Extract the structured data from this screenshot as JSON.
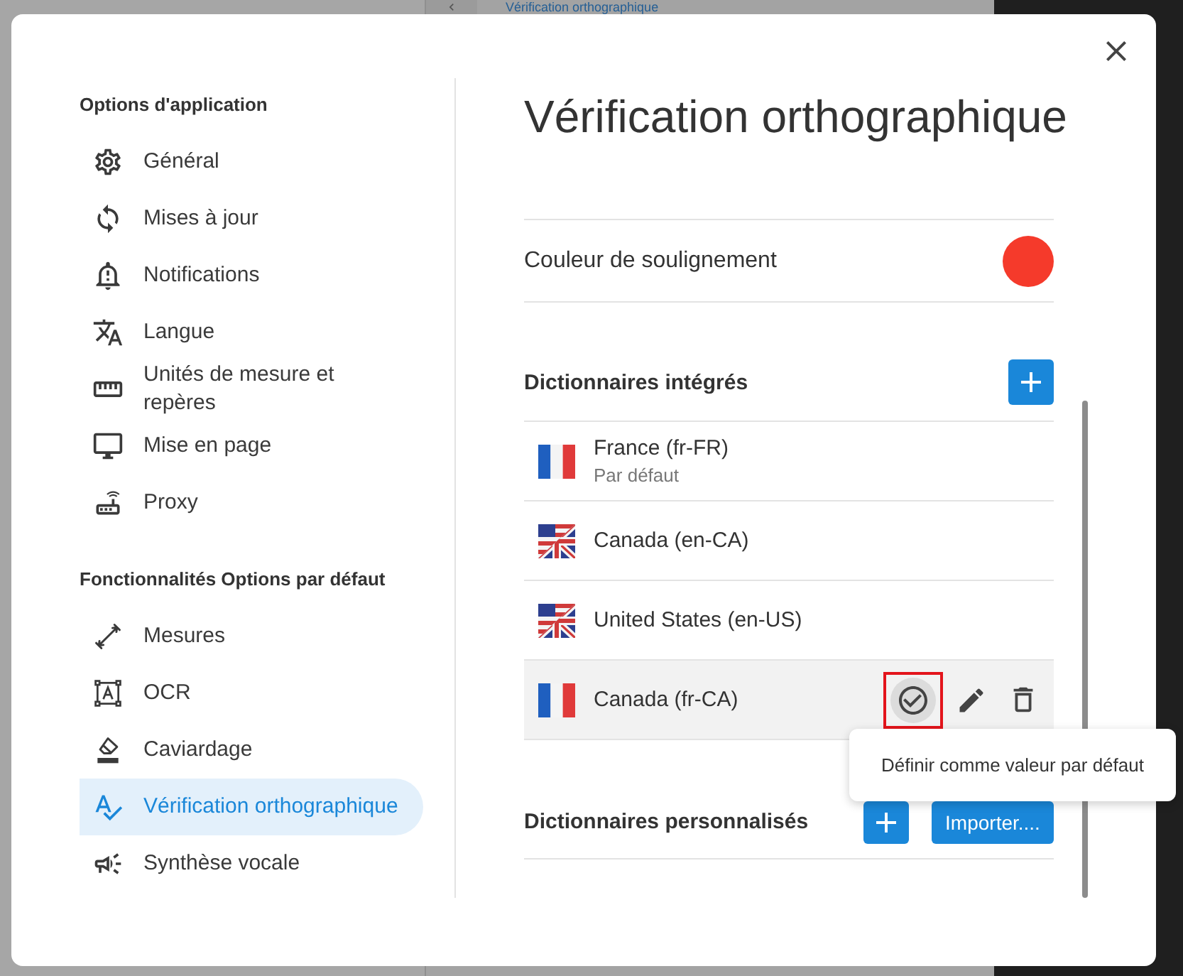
{
  "backdrop": {
    "heading": "Vérification orthographique"
  },
  "sidebar": {
    "sections": [
      {
        "title": "Options d'application",
        "items": [
          {
            "label": "Général",
            "selected": false
          },
          {
            "label": "Mises à jour",
            "selected": false
          },
          {
            "label": "Notifications",
            "selected": false
          },
          {
            "label": "Langue",
            "selected": false
          },
          {
            "label": "Unités de mesure et repères",
            "selected": false
          },
          {
            "label": "Mise en page",
            "selected": false
          },
          {
            "label": "Proxy",
            "selected": false
          }
        ]
      },
      {
        "title": "Fonctionnalités Options par défaut",
        "items": [
          {
            "label": "Mesures",
            "selected": false
          },
          {
            "label": "OCR",
            "selected": false
          },
          {
            "label": "Caviardage",
            "selected": false
          },
          {
            "label": "Vérification orthographique",
            "selected": true
          },
          {
            "label": "Synthèse vocale",
            "selected": false
          }
        ]
      }
    ]
  },
  "page": {
    "title": "Vérification orthographique",
    "underline_color": {
      "label": "Couleur de soulignement",
      "color": "#f53a2b"
    },
    "builtin_dictionaries": {
      "title": "Dictionnaires intégrés",
      "items": [
        {
          "name": "France (fr-FR)",
          "subtitle": "Par défaut",
          "kind": "french",
          "hovered": false
        },
        {
          "name": "Canada (en-CA)",
          "kind": "english",
          "hovered": false
        },
        {
          "name": "United States (en-US)",
          "kind": "english",
          "hovered": false
        },
        {
          "name": "Canada (fr-CA)",
          "kind": "french",
          "hovered": true
        }
      ]
    },
    "tooltip": {
      "text": "Définir comme valeur par défaut"
    },
    "custom_dictionaries": {
      "title": "Dictionnaires personnalisés",
      "import_button": "Importer...."
    }
  }
}
